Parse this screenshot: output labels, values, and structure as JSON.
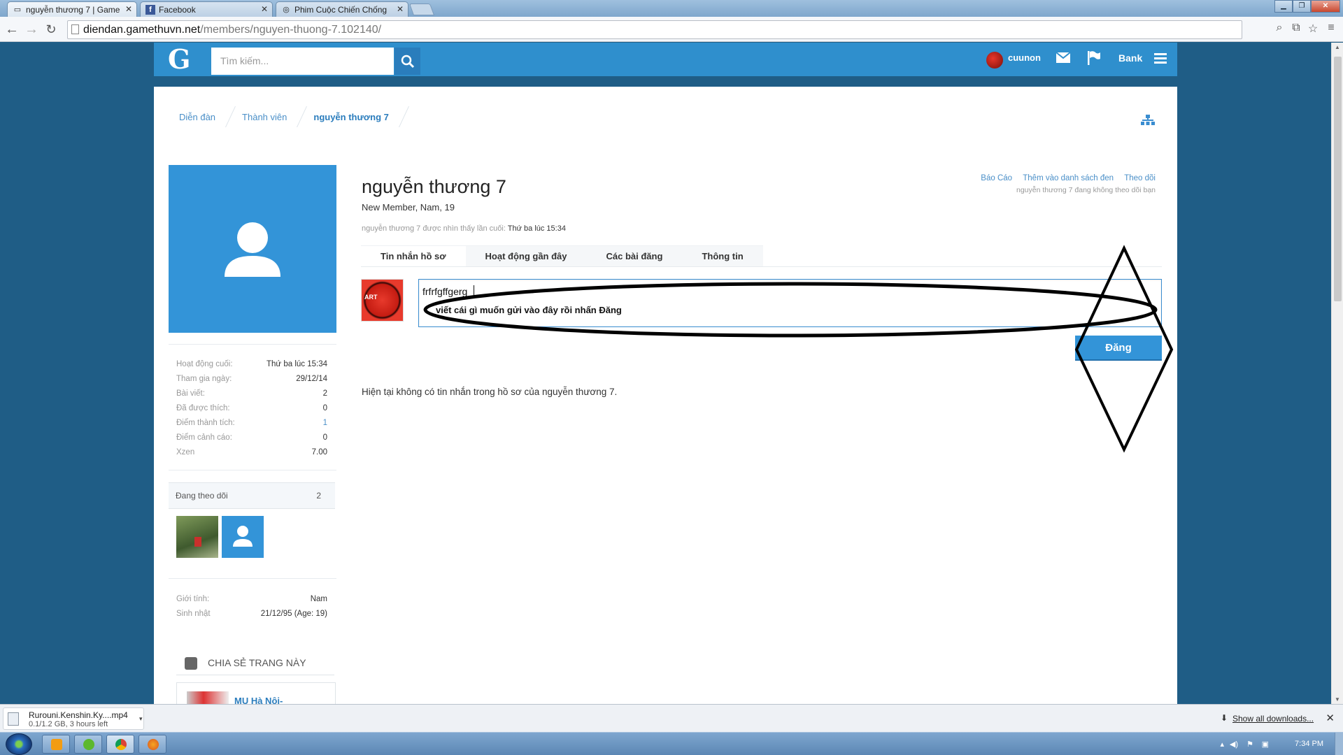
{
  "browser": {
    "tabs": [
      {
        "title": "nguyễn thương 7 | Game",
        "icon": "page-icon",
        "active": true
      },
      {
        "title": "Facebook",
        "icon": "facebook-icon",
        "active": false
      },
      {
        "title": "Phim Cuộc Chiến Chống",
        "icon": "globe-icon",
        "active": false
      }
    ],
    "url_host": "diendan.gamethuvn.net",
    "url_path": "/members/nguyen-thuong-7.102140/"
  },
  "site": {
    "logo": "G",
    "search_placeholder": "Tìm kiếm...",
    "username": "cuunon",
    "bank_label": "Bank"
  },
  "breadcrumb": [
    "Diễn đàn",
    "Thành viên",
    "nguyễn thương 7"
  ],
  "profile": {
    "name": "nguyễn thương 7",
    "title": "New Member, Nam, 19",
    "last_seen_prefix": "nguyễn thương 7 được nhìn thấy lần cuối:",
    "last_seen_value": "Thứ ba lúc 15:34",
    "actions": [
      "Báo Cáo",
      "Thêm vào danh sách đen",
      "Theo dõi"
    ],
    "follow_status": "nguyễn thương 7 đang không theo dõi bạn"
  },
  "stats": [
    {
      "label": "Hoạt động cuối:",
      "value": "Thứ ba lúc 15:34"
    },
    {
      "label": "Tham gia ngày:",
      "value": "29/12/14"
    },
    {
      "label": "Bài viết:",
      "value": "2"
    },
    {
      "label": "Đã được thích:",
      "value": "0"
    },
    {
      "label": "Điểm thành tích:",
      "value": "1"
    },
    {
      "label": "Điểm cảnh cáo:",
      "value": "0"
    },
    {
      "label": "Xzen",
      "value": "7.00"
    }
  ],
  "following": {
    "label": "Đang theo dõi",
    "count": "2"
  },
  "info": [
    {
      "label": "Giới tính:",
      "value": "Nam"
    },
    {
      "label": "Sinh nhật",
      "value": "21/12/95 (Age: 19)"
    }
  ],
  "share": {
    "title": "CHIA SẺ TRANG NÀY",
    "card_title": "MU Hà Nội-"
  },
  "poster_avatar_label": "ART",
  "tabs": [
    "Tin nhắn hồ sơ",
    "Hoạt động gần đây",
    "Các bài đăng",
    "Thông tin"
  ],
  "message": {
    "text": "frfrfgffgerg",
    "hint": "viết cái gì muốn gửi vào đây rồi nhấn Đăng",
    "post_button": "Đăng",
    "empty": "Hiện tại không có tin nhắn trong hồ sơ của nguyễn thương 7."
  },
  "download": {
    "filename": "Rurouni.Kenshin.Ky....mp4",
    "status": "0.1/1.2 GB, 3 hours left",
    "show_all": "Show all downloads..."
  },
  "taskbar": {
    "clock": "7:34 PM"
  }
}
